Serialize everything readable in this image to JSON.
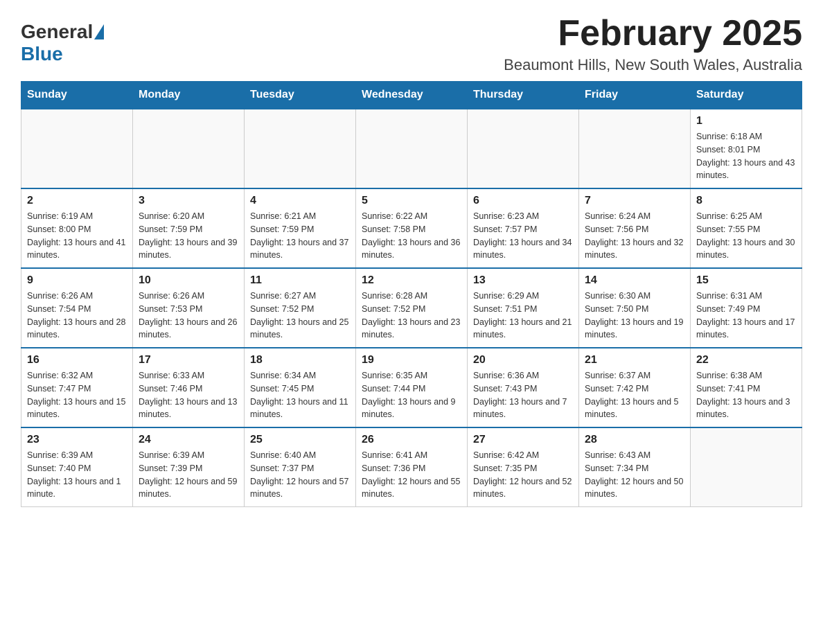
{
  "logo": {
    "general": "General",
    "blue": "Blue"
  },
  "header": {
    "title": "February 2025",
    "subtitle": "Beaumont Hills, New South Wales, Australia"
  },
  "weekdays": [
    "Sunday",
    "Monday",
    "Tuesday",
    "Wednesday",
    "Thursday",
    "Friday",
    "Saturday"
  ],
  "weeks": [
    [
      {
        "day": "",
        "info": ""
      },
      {
        "day": "",
        "info": ""
      },
      {
        "day": "",
        "info": ""
      },
      {
        "day": "",
        "info": ""
      },
      {
        "day": "",
        "info": ""
      },
      {
        "day": "",
        "info": ""
      },
      {
        "day": "1",
        "info": "Sunrise: 6:18 AM\nSunset: 8:01 PM\nDaylight: 13 hours and 43 minutes."
      }
    ],
    [
      {
        "day": "2",
        "info": "Sunrise: 6:19 AM\nSunset: 8:00 PM\nDaylight: 13 hours and 41 minutes."
      },
      {
        "day": "3",
        "info": "Sunrise: 6:20 AM\nSunset: 7:59 PM\nDaylight: 13 hours and 39 minutes."
      },
      {
        "day": "4",
        "info": "Sunrise: 6:21 AM\nSunset: 7:59 PM\nDaylight: 13 hours and 37 minutes."
      },
      {
        "day": "5",
        "info": "Sunrise: 6:22 AM\nSunset: 7:58 PM\nDaylight: 13 hours and 36 minutes."
      },
      {
        "day": "6",
        "info": "Sunrise: 6:23 AM\nSunset: 7:57 PM\nDaylight: 13 hours and 34 minutes."
      },
      {
        "day": "7",
        "info": "Sunrise: 6:24 AM\nSunset: 7:56 PM\nDaylight: 13 hours and 32 minutes."
      },
      {
        "day": "8",
        "info": "Sunrise: 6:25 AM\nSunset: 7:55 PM\nDaylight: 13 hours and 30 minutes."
      }
    ],
    [
      {
        "day": "9",
        "info": "Sunrise: 6:26 AM\nSunset: 7:54 PM\nDaylight: 13 hours and 28 minutes."
      },
      {
        "day": "10",
        "info": "Sunrise: 6:26 AM\nSunset: 7:53 PM\nDaylight: 13 hours and 26 minutes."
      },
      {
        "day": "11",
        "info": "Sunrise: 6:27 AM\nSunset: 7:52 PM\nDaylight: 13 hours and 25 minutes."
      },
      {
        "day": "12",
        "info": "Sunrise: 6:28 AM\nSunset: 7:52 PM\nDaylight: 13 hours and 23 minutes."
      },
      {
        "day": "13",
        "info": "Sunrise: 6:29 AM\nSunset: 7:51 PM\nDaylight: 13 hours and 21 minutes."
      },
      {
        "day": "14",
        "info": "Sunrise: 6:30 AM\nSunset: 7:50 PM\nDaylight: 13 hours and 19 minutes."
      },
      {
        "day": "15",
        "info": "Sunrise: 6:31 AM\nSunset: 7:49 PM\nDaylight: 13 hours and 17 minutes."
      }
    ],
    [
      {
        "day": "16",
        "info": "Sunrise: 6:32 AM\nSunset: 7:47 PM\nDaylight: 13 hours and 15 minutes."
      },
      {
        "day": "17",
        "info": "Sunrise: 6:33 AM\nSunset: 7:46 PM\nDaylight: 13 hours and 13 minutes."
      },
      {
        "day": "18",
        "info": "Sunrise: 6:34 AM\nSunset: 7:45 PM\nDaylight: 13 hours and 11 minutes."
      },
      {
        "day": "19",
        "info": "Sunrise: 6:35 AM\nSunset: 7:44 PM\nDaylight: 13 hours and 9 minutes."
      },
      {
        "day": "20",
        "info": "Sunrise: 6:36 AM\nSunset: 7:43 PM\nDaylight: 13 hours and 7 minutes."
      },
      {
        "day": "21",
        "info": "Sunrise: 6:37 AM\nSunset: 7:42 PM\nDaylight: 13 hours and 5 minutes."
      },
      {
        "day": "22",
        "info": "Sunrise: 6:38 AM\nSunset: 7:41 PM\nDaylight: 13 hours and 3 minutes."
      }
    ],
    [
      {
        "day": "23",
        "info": "Sunrise: 6:39 AM\nSunset: 7:40 PM\nDaylight: 13 hours and 1 minute."
      },
      {
        "day": "24",
        "info": "Sunrise: 6:39 AM\nSunset: 7:39 PM\nDaylight: 12 hours and 59 minutes."
      },
      {
        "day": "25",
        "info": "Sunrise: 6:40 AM\nSunset: 7:37 PM\nDaylight: 12 hours and 57 minutes."
      },
      {
        "day": "26",
        "info": "Sunrise: 6:41 AM\nSunset: 7:36 PM\nDaylight: 12 hours and 55 minutes."
      },
      {
        "day": "27",
        "info": "Sunrise: 6:42 AM\nSunset: 7:35 PM\nDaylight: 12 hours and 52 minutes."
      },
      {
        "day": "28",
        "info": "Sunrise: 6:43 AM\nSunset: 7:34 PM\nDaylight: 12 hours and 50 minutes."
      },
      {
        "day": "",
        "info": ""
      }
    ]
  ]
}
